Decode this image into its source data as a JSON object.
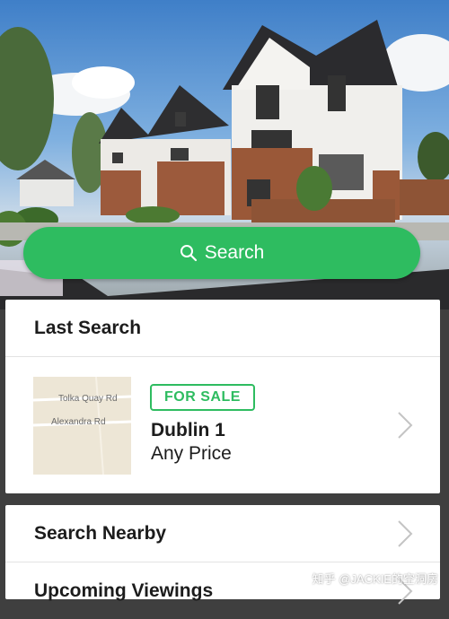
{
  "search_button": {
    "label": "Search",
    "icon": "search-icon"
  },
  "last_search": {
    "title": "Last Search",
    "item": {
      "badge": "FOR SALE",
      "area": "Dublin 1",
      "price": "Any Price",
      "map_labels": [
        "Tolka Quay Rd",
        "Alexandra Rd"
      ]
    }
  },
  "rows": [
    {
      "label": "Search Nearby"
    },
    {
      "label": "Upcoming Viewings"
    }
  ],
  "watermark": "知乎 @JACKIE的空洞房",
  "colors": {
    "accent": "#2ebc60"
  }
}
